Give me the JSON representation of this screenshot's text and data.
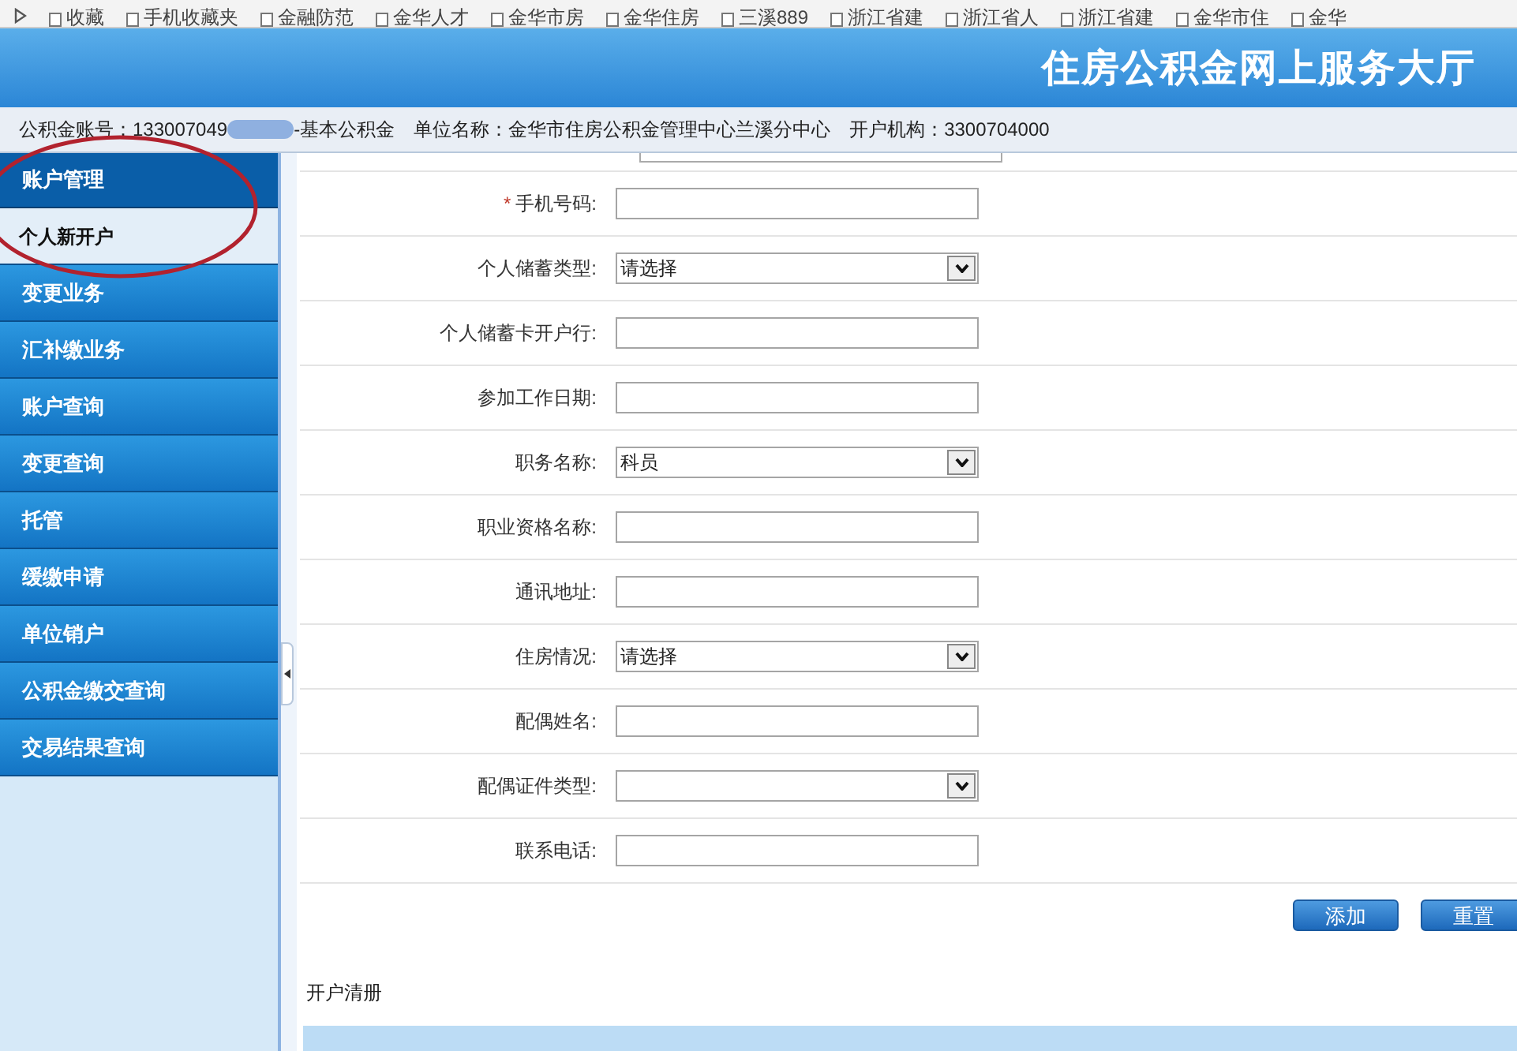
{
  "bookmarks": [
    {
      "label": "收藏"
    },
    {
      "label": "手机收藏夹"
    },
    {
      "label": "金融防范"
    },
    {
      "label": "金华人才"
    },
    {
      "label": "金华市房"
    },
    {
      "label": "金华住房"
    },
    {
      "label": "三溪889"
    },
    {
      "label": "浙江省建"
    },
    {
      "label": "浙江省人"
    },
    {
      "label": "浙江省建"
    },
    {
      "label": "金华市住"
    },
    {
      "label": "金华"
    }
  ],
  "header": {
    "title": "住房公积金网上服务大厅"
  },
  "info_bar": {
    "account_label": "公积金账号：",
    "account_value": "133007049",
    "account_suffix": "-基本公积金",
    "unit_label": "单位名称：",
    "unit_value": "金华市住房公积金管理中心兰溪分中心",
    "org_label": "开户机构：",
    "org_value": "3300704000"
  },
  "sidebar": {
    "section": "账户管理",
    "items": [
      {
        "label": "个人新开户",
        "selected": true
      },
      {
        "label": "变更业务",
        "selected": false
      },
      {
        "label": "汇补缴业务",
        "selected": false
      },
      {
        "label": "账户查询",
        "selected": false
      },
      {
        "label": "变更查询",
        "selected": false
      },
      {
        "label": "托管",
        "selected": false
      },
      {
        "label": "缓缴申请",
        "selected": false
      },
      {
        "label": "单位销户",
        "selected": false
      },
      {
        "label": "公积金缴交查询",
        "selected": false
      },
      {
        "label": "交易结果查询",
        "selected": false
      }
    ]
  },
  "form": {
    "fields": [
      {
        "label": "手机号码:",
        "kind": "text",
        "required_mark": "*"
      },
      {
        "label": "个人储蓄类型:",
        "kind": "select",
        "value": "请选择"
      },
      {
        "label": "个人储蓄卡开户行:",
        "kind": "text"
      },
      {
        "label": "参加工作日期:",
        "kind": "text"
      },
      {
        "label": "职务名称:",
        "kind": "select",
        "value": "科员"
      },
      {
        "label": "职业资格名称:",
        "kind": "text"
      },
      {
        "label": "通讯地址:",
        "kind": "text"
      },
      {
        "label": "住房情况:",
        "kind": "select",
        "value": "请选择"
      },
      {
        "label": "配偶姓名:",
        "kind": "text"
      },
      {
        "label": "配偶证件类型:",
        "kind": "select"
      },
      {
        "label": "联系电话:",
        "kind": "text"
      }
    ],
    "buttons": [
      "添加",
      "重置"
    ]
  },
  "register": {
    "title": "开户清册"
  }
}
